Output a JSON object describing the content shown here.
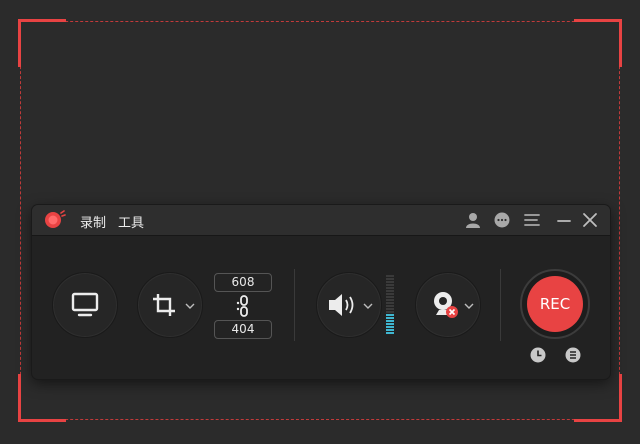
{
  "window": {
    "title": ""
  },
  "menu": {
    "record": "录制",
    "tools": "工具"
  },
  "titlebar_icons": [
    "user-icon",
    "chat-icon",
    "hamburger-menu-icon",
    "minimize-icon",
    "close-icon"
  ],
  "region": {
    "width": "608",
    "height": "404"
  },
  "record_button": {
    "label": "REC"
  },
  "colors": {
    "accent": "#e84343",
    "panel": "#222222",
    "meter": "#3fb6d0"
  },
  "audio_level": 0.35,
  "icons": {
    "screen": "monitor-icon",
    "crop": "crop-icon",
    "link": "link-icon",
    "speaker": "speaker-icon",
    "webcam": "webcam-icon",
    "timer": "clock-icon",
    "history": "list-icon"
  }
}
